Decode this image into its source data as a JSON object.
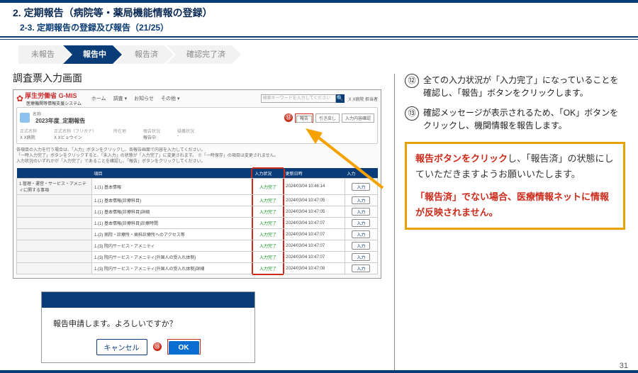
{
  "headings": {
    "h2": "2. 定期報告（病院等・薬局機能情報の登録）",
    "h3": "2-3. 定期報告の登録及び報告（21/25）",
    "section": "調査票入力画面"
  },
  "steps": [
    "未報告",
    "報告中",
    "報告済",
    "確認完了済"
  ],
  "steps_active_index": 1,
  "gmis": {
    "title": "厚生労働省 G-MIS",
    "sub": "医療機関等情報支援システム",
    "nav": [
      "ホーム",
      "調査 ▾",
      "お知らせ",
      "その他 ▾"
    ],
    "search_placeholder": "検索キーワードを入力してください",
    "user": "X X病院 担当者"
  },
  "card": {
    "tag": "名称",
    "title": "2023年度_定期報告",
    "badge12": "⑫",
    "buttons": [
      "報告",
      "引き戻し",
      "入力内容確認"
    ],
    "info": [
      {
        "k": "正式名称",
        "v": "X X病院"
      },
      {
        "k": "正式名称（フリガナ）",
        "v": "X Xビョウイン"
      },
      {
        "k": "所在地",
        "v": ""
      },
      {
        "k": "報告状況",
        "v": "報告中"
      },
      {
        "k": "疑義状況",
        "v": "-"
      }
    ]
  },
  "note_lines": [
    "各項目の入力を行う場合は、「入力」ボタンをクリックし、各報告画面で内容を入力してください。",
    "「一時入力完了」ボタンをクリックすると、「未入力」の状態が「入力完了」に変更されます。 ※「一時保存」の項目は変更されません。",
    "入力状況のいずれかが「入力完了」であることを確認し、「報告」ボタンをクリックしてください。"
  ],
  "table": {
    "headers": [
      "",
      "項目",
      "入力状況",
      "更新日時",
      "入力"
    ],
    "rows": [
      {
        "cat": "1.管理・運営・サービス・アメニティに関する事項",
        "item": "1.(1) 基本情報",
        "status": "入力完了",
        "time": "2024/03/04 10:46:14"
      },
      {
        "cat": "",
        "item": "1.(1) 基本情報(診療科目)",
        "status": "入力完了",
        "time": "2024/03/04 10:47:05"
      },
      {
        "cat": "",
        "item": "1.(1) 基本情報(診療科目)詳細",
        "status": "入力完了",
        "time": "2024/03/04 10:47:05"
      },
      {
        "cat": "",
        "item": "1.(1) 基本情報(診療科目)診療時間",
        "status": "入力完了",
        "time": "2024/03/04 10:47:07"
      },
      {
        "cat": "",
        "item": "1.(2) 病院・診療所・歯科診療所へのアクセス等",
        "status": "入力完了",
        "time": "2024/03/04 10:47:07"
      },
      {
        "cat": "",
        "item": "1.(3) 院内サービス・アメニティ",
        "status": "入力完了",
        "time": "2024/03/04 10:47:07"
      },
      {
        "cat": "",
        "item": "1.(3) 院内サービス・アメニティ(外国人の受入れ体制)",
        "status": "入力完了",
        "time": "2024/03/04 10:47:07"
      },
      {
        "cat": "",
        "item": "1.(3) 院内サービス・アメニティ(外国人の受入れ体制)詳細",
        "status": "入力完了",
        "time": "2024/03/04 10:47:08"
      }
    ],
    "action": "入力"
  },
  "modal": {
    "msg": "報告申請します。よろしいですか？",
    "cancel": "キャンセル",
    "badge13": "⑬",
    "ok": "OK"
  },
  "instructions": [
    {
      "n": "⑫",
      "t": "全ての入力状況が「入力完了」になっていることを確認し、「報告」ボタンをクリックします。"
    },
    {
      "n": "⑬",
      "t": "確認メッセージが表示されるため、「OK」ボタンをクリックし、機関情報を報告します。"
    }
  ],
  "callout": {
    "hl": "報告ボタンをクリック",
    "body1": "し、「報告済」の状態にしていただきますようお願いいたします。",
    "warn": "「報告済」でない場合、医療情報ネットに情報が反映されません。"
  },
  "page_num": "31"
}
